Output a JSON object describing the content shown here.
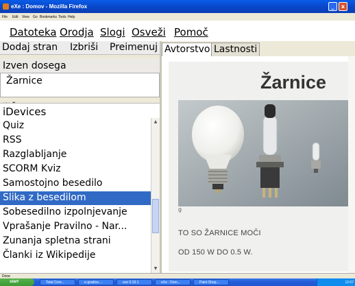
{
  "window": {
    "title": "eXe : Domov - Mozilla Firefox",
    "minimize": "_",
    "close": "x"
  },
  "firefox_menu": [
    "File",
    "Edit",
    "View",
    "Go",
    "Bookmarks",
    "Tools",
    "Help"
  ],
  "app_menu": [
    "Datoteka",
    "Orodja",
    "Slogi",
    "Osveži",
    "Pomoč"
  ],
  "outline_toolbar": [
    "Dodaj stran",
    "Izbriši",
    "Preimenuj"
  ],
  "outline": {
    "header": "Izven dosega",
    "node": "Žarnice",
    "move_arrows": "◄ ▲ ► ▼"
  },
  "idevices": {
    "header": "iDevices",
    "items": [
      "Quiz",
      "RSS",
      "Razglabljanje",
      "SCORM Kviz",
      "Samostojno besedilo",
      "Slika z besedilom",
      "Sobesedilno izpolnjevanje",
      "Vprašanje Pravilno - Nar...",
      "Zunanja spletna strani",
      "Članki iz Wikipedije"
    ],
    "selected_index": 5
  },
  "tabs": [
    "Avtorstvo",
    "Lastnosti"
  ],
  "page": {
    "title": "Žarnice",
    "lines": [
      "TO SO ŽARNICE  MOČI",
      "OD 150 W DO 0.5 W."
    ]
  },
  "status": "Done",
  "taskbar": {
    "start": "start",
    "tasks": [
      "Total Com...",
      "e-gradiva ...",
      "exe 0.19.1",
      "eXe : Dom...",
      "Paint Shop..."
    ],
    "clock": "12:07"
  },
  "colors": {
    "selection": "#316ac5",
    "titlebar": "#0846c8",
    "taskbar": "#245edb",
    "start": "#3d9a35"
  }
}
